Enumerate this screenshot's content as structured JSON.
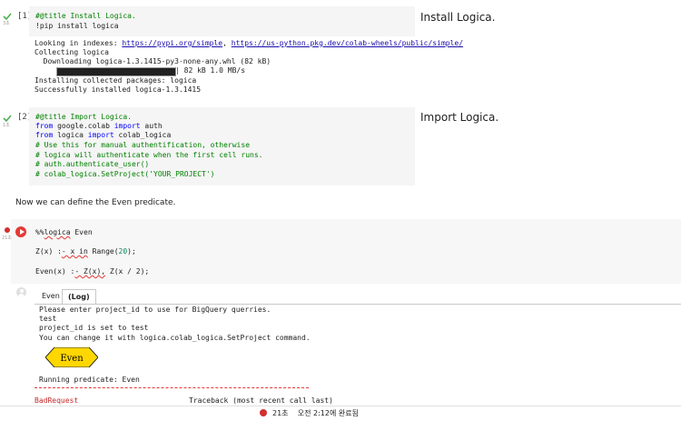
{
  "cell1": {
    "label": "[1]",
    "exec_time": "3초",
    "code": [
      "#@title Install Logica.",
      "!pip install logica"
    ],
    "form_title": "Install Logica.",
    "output": {
      "indexes_prefix": "Looking in indexes: ",
      "link1": "https://pypi.org/simple",
      "sep": ", ",
      "link2": "https://us-python.pkg.dev/colab-wheels/public/simple/",
      "collecting": "Collecting logica",
      "downloading": "  Downloading logica-1.3.1415-py3-none-any.whl (82 kB)",
      "progress_text": "| 82 kB 1.0 MB/s",
      "progress_fraction": 1.0,
      "installing": "Installing collected packages: logica",
      "success": "Successfully installed logica-1.3.1415"
    }
  },
  "cell2": {
    "label": "[2]",
    "exec_time": "1초",
    "form_title": "Import Logica.",
    "code": {
      "title": "#@title Import Logica.",
      "line2_kw1": "from",
      "line2_mod": " google.colab ",
      "line2_kw2": "import",
      "line2_rest": " auth",
      "line3_kw1": "from",
      "line3_mod": " logica ",
      "line3_kw2": "import",
      "line3_rest": " colab_logica",
      "c1": "# Use this for manual authentification, otherwise",
      "c2": "# logica will authenticate when the first cell runs.",
      "c3": "# auth.authenticate_user()",
      "c4": "# colab_logica.SetProject('YOUR_PROJECT')"
    }
  },
  "markdown": {
    "text": "Now we can define the Even predicate."
  },
  "cell3": {
    "exec_time": "21초",
    "line1_prefix": "%%",
    "line1_word": "logica",
    "line1_rest": " Even",
    "line2_a": "Z(x) :",
    "line2_b": "- x in",
    "line2_c": " Range(",
    "line2_num": "20",
    "line2_d": ");",
    "line3_a": "Even(x) :",
    "line3_b": "- Z(x),",
    "line3_c": " Z(x / 2);"
  },
  "output": {
    "tabs": [
      "Even",
      "(Log)"
    ],
    "log": [
      "Please enter project_id to use for BigQuery querries.",
      "test",
      "project_id is set to test",
      "You can change it with logica.colab_logica.SetProject command."
    ],
    "node_label": "Even",
    "running": "Running predicate: Even",
    "error_name": "BadRequest",
    "traceback": "Traceback (most recent call last)"
  },
  "status": {
    "time": "21초",
    "completed": "오전 2:12에 완료됨"
  },
  "colors": {
    "accent_red": "#e53935",
    "node_fill": "#ffd700",
    "comment_green": "#008000",
    "keyword_blue": "#0000ff",
    "link_blue": "#1a0dab"
  }
}
